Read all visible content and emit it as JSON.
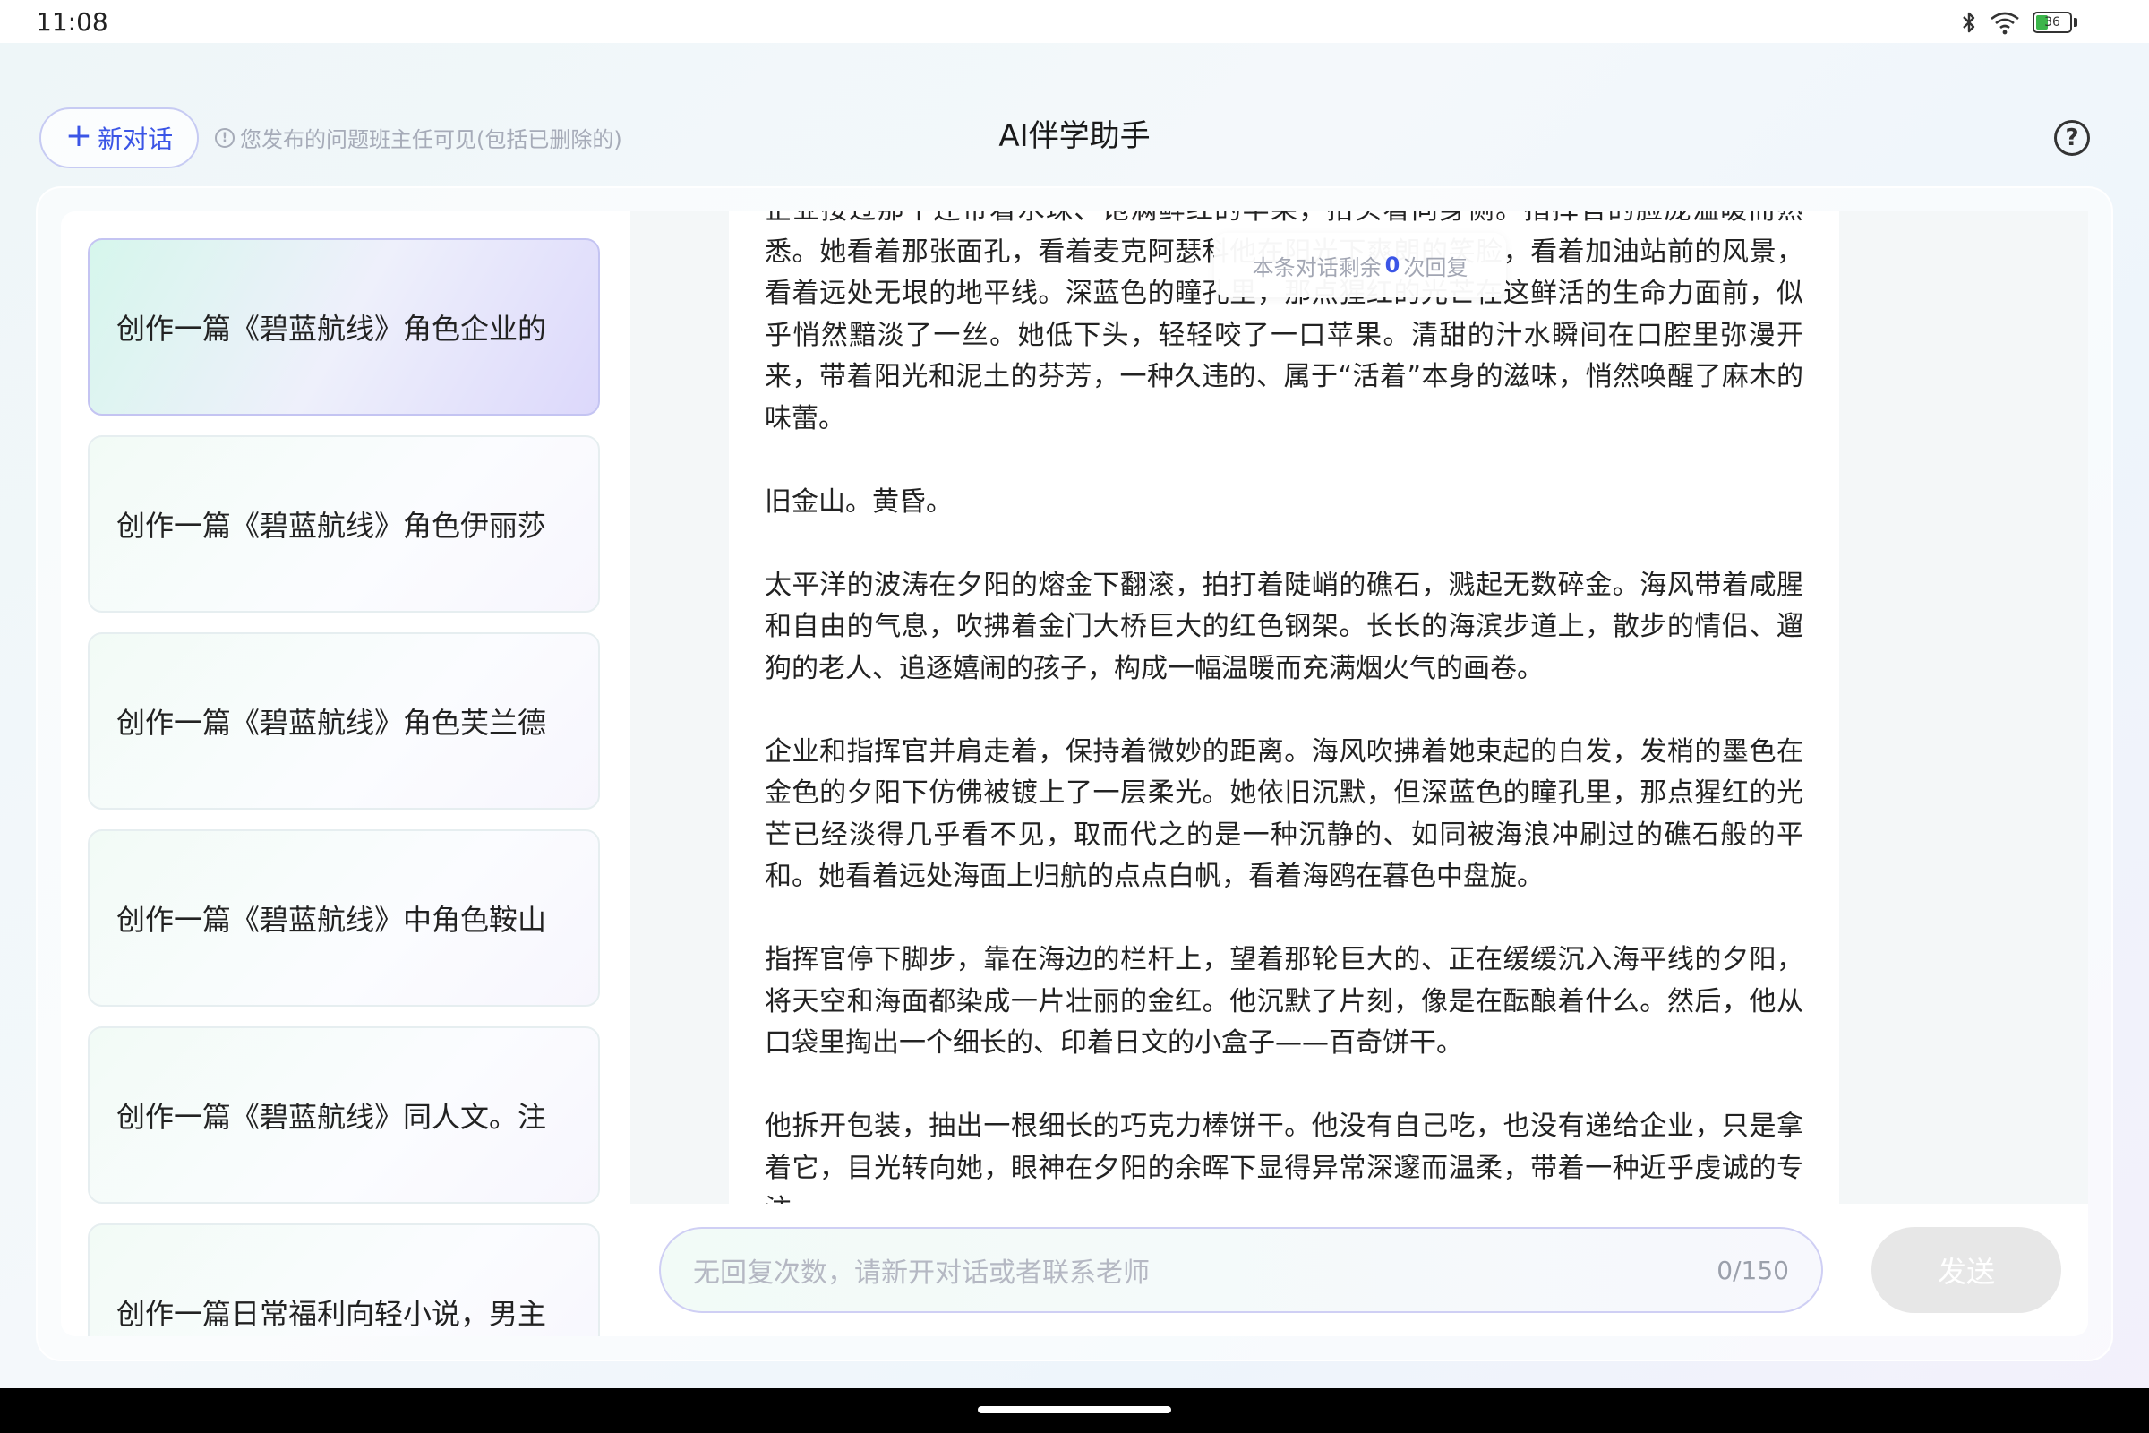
{
  "status_bar": {
    "time": "11:08",
    "battery_level": "36",
    "battery_fraction": 0.36
  },
  "header": {
    "new_chat_label": "新对话",
    "notice": "您发布的问题班主任可见(包括已删除的)",
    "title": "AI伴学助手"
  },
  "sidebar": {
    "items": [
      {
        "label": "创作一篇《碧蓝航线》角色企业的"
      },
      {
        "label": "创作一篇《碧蓝航线》角色伊丽莎"
      },
      {
        "label": "创作一篇《碧蓝航线》角色芙兰德"
      },
      {
        "label": "创作一篇《碧蓝航线》中角色鞍山"
      },
      {
        "label": "创作一篇《碧蓝航线》同人文。注"
      },
      {
        "label": "创作一篇日常福利向轻小说，男主"
      }
    ]
  },
  "message": {
    "paragraphs": [
      "企业接过那个还带着水珠、饱满鲜红的苹果，抬头看向身侧。指挥官的脸庞温暖而熟悉。她看着那张面孔，看着麦克阿瑟科他在阳光下爽朗的笑脸，看着加油站前的风景，看着远处无垠的地平线。深蓝色的瞳孔里，那点猩红的光芒在这鲜活的生命力面前，似乎悄然黯淡了一丝。她低下头，轻轻咬了一口苹果。清甜的汁水瞬间在口腔里弥漫开来，带着阳光和泥土的芬芳，一种久违的、属于“活着”本身的滋味，悄然唤醒了麻木的味蕾。",
      "旧金山。黄昏。",
      "太平洋的波涛在夕阳的熔金下翻滚，拍打着陡峭的礁石，溅起无数碎金。海风带着咸腥和自由的气息，吹拂着金门大桥巨大的红色钢架。长长的海滨步道上，散步的情侣、遛狗的老人、追逐嬉闹的孩子，构成一幅温暖而充满烟火气的画卷。",
      "企业和指挥官并肩走着，保持着微妙的距离。海风吹拂着她束起的白发，发梢的墨色在金色的夕阳下仿佛被镀上了一层柔光。她依旧沉默，但深蓝色的瞳孔里，那点猩红的光芒已经淡得几乎看不见，取而代之的是一种沉静的、如同被海浪冲刷过的礁石般的平和。她看着远处海面上归航的点点白帆，看着海鸥在暮色中盘旋。",
      "指挥官停下脚步，靠在海边的栏杆上，望着那轮巨大的、正在缓缓沉入海平线的夕阳，将天空和海面都染成一片壮丽的金红。他沉默了片刻，像是在酝酿着什么。然后，他从口袋里掏出一个细长的、印着日文的小盒子——百奇饼干。",
      "他拆开包装，抽出一根细长的巧克力棒饼干。他没有自己吃，也没有递给企业，只是拿着它，目光转向她，眼神在夕阳的余晖下显得异常深邃而温柔，带着一种近乎虔诚的专注。"
    ]
  },
  "remaining": {
    "prefix": "本条对话剩余",
    "count": "0",
    "suffix": "次回复"
  },
  "input": {
    "placeholder": "无回复次数，请新开对话或者联系老师",
    "char_count": "0/150",
    "send_label": "发送"
  }
}
